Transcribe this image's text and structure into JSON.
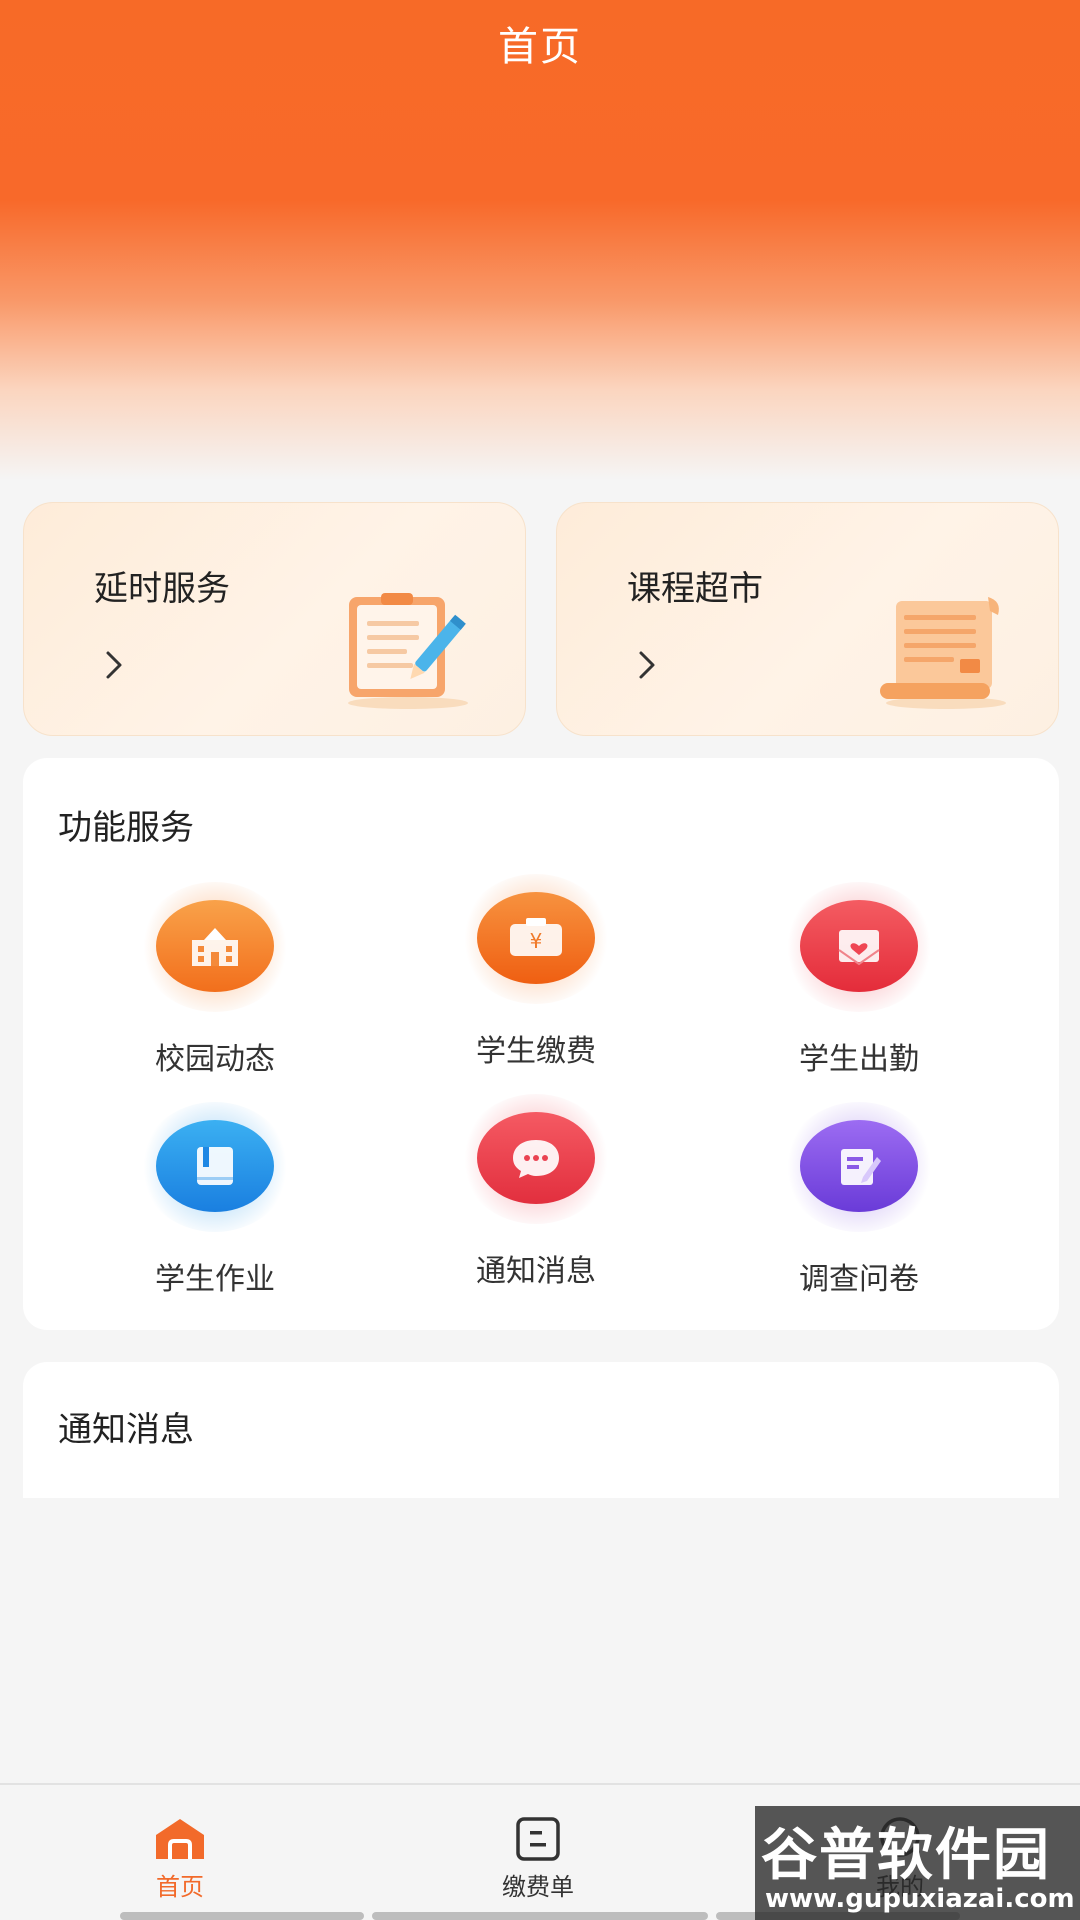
{
  "header": {
    "title": "首页"
  },
  "promo_cards": [
    {
      "title": "延时服务",
      "arrow": "chevron-right-icon",
      "illustration": "clipboard-pen-icon"
    },
    {
      "title": "课程超市",
      "arrow": "chevron-right-icon",
      "illustration": "scroll-document-icon"
    }
  ],
  "services": {
    "title": "功能服务",
    "items": [
      {
        "label": "校园动态",
        "icon": "school-building-icon",
        "color": "#f57a1f"
      },
      {
        "label": "学生缴费",
        "icon": "yen-wallet-icon",
        "color": "#f4731c"
      },
      {
        "label": "学生出勤",
        "icon": "heart-envelope-icon",
        "color": "#ee3b48"
      },
      {
        "label": "学生作业",
        "icon": "book-icon",
        "color": "#2296ea"
      },
      {
        "label": "通知消息",
        "icon": "chat-bubble-icon",
        "color": "#ee3d4b"
      },
      {
        "label": "调查问卷",
        "icon": "edit-form-icon",
        "color": "#7b4ce2"
      }
    ]
  },
  "notice": {
    "title": "通知消息"
  },
  "tabbar": {
    "items": [
      {
        "label": "首页",
        "icon": "home-icon",
        "active": true
      },
      {
        "label": "缴费单",
        "icon": "bill-icon",
        "active": false
      },
      {
        "label": "我的",
        "icon": "profile-icon",
        "active": false
      }
    ],
    "active_color": "#f26a2a"
  },
  "watermark": {
    "brand": "谷普软件园",
    "url": "www.gupuxiazai.com"
  }
}
